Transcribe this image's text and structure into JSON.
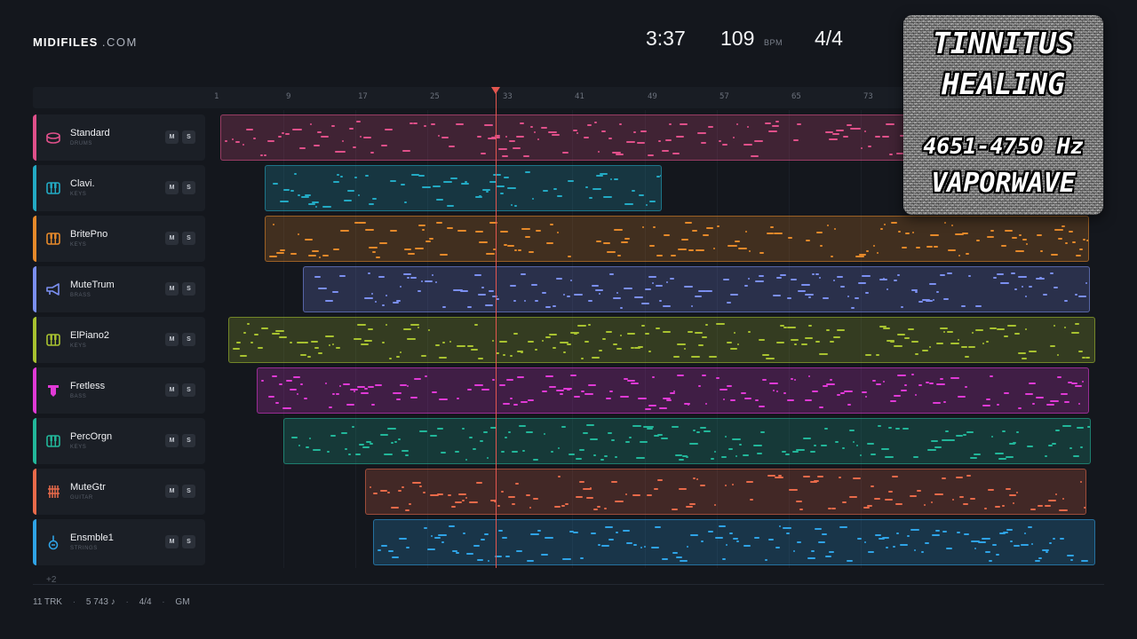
{
  "brand": {
    "name": "MIDIFILES",
    "domain": ".COM"
  },
  "transport": {
    "time": "3:37",
    "bpm": "109",
    "bpm_unit": "BPM",
    "signature": "4/4"
  },
  "ruler": {
    "ticks": [
      "1",
      "9",
      "17",
      "25",
      "33",
      "41",
      "49",
      "57",
      "65",
      "73"
    ],
    "playhead_bar": 33
  },
  "tracks": [
    {
      "name": "Standard",
      "category": "DRUMS",
      "color": "#e0508a",
      "icon": "drum-icon",
      "mute": "M",
      "solo": "S"
    },
    {
      "name": "Clavi.",
      "category": "KEYS",
      "color": "#23aac4",
      "icon": "keys-icon",
      "mute": "M",
      "solo": "S"
    },
    {
      "name": "BritePno",
      "category": "KEYS",
      "color": "#e5892a",
      "icon": "keys-icon",
      "mute": "M",
      "solo": "S"
    },
    {
      "name": "MuteTrum",
      "category": "BRASS",
      "color": "#7b8ff0",
      "icon": "trumpet-icon",
      "mute": "M",
      "solo": "S"
    },
    {
      "name": "ElPiano2",
      "category": "KEYS",
      "color": "#a8c230",
      "icon": "keys-icon",
      "mute": "M",
      "solo": "S"
    },
    {
      "name": "Fretless",
      "category": "BASS",
      "color": "#e03ad6",
      "icon": "bass-icon",
      "mute": "M",
      "solo": "S"
    },
    {
      "name": "PercOrgn",
      "category": "KEYS",
      "color": "#22b79a",
      "icon": "keys-icon",
      "mute": "M",
      "solo": "S"
    },
    {
      "name": "MuteGtr",
      "category": "GUITAR",
      "color": "#e86a4a",
      "icon": "guitar-icon",
      "mute": "M",
      "solo": "S"
    },
    {
      "name": "Ensmble1",
      "category": "STRINGS",
      "color": "#2fa3e6",
      "icon": "strings-icon",
      "mute": "M",
      "solo": "S"
    }
  ],
  "more_tracks": "+2",
  "footer": {
    "tracks": "11 TRK",
    "notes": "5 743 ♪",
    "signature": "4/4",
    "standard": "GM",
    "separator": "·"
  },
  "overlay": {
    "line1": "TINNITUS",
    "line2": "HEALING",
    "line3": "4651-4750 Hz",
    "line4": "VAPORWAVE"
  }
}
